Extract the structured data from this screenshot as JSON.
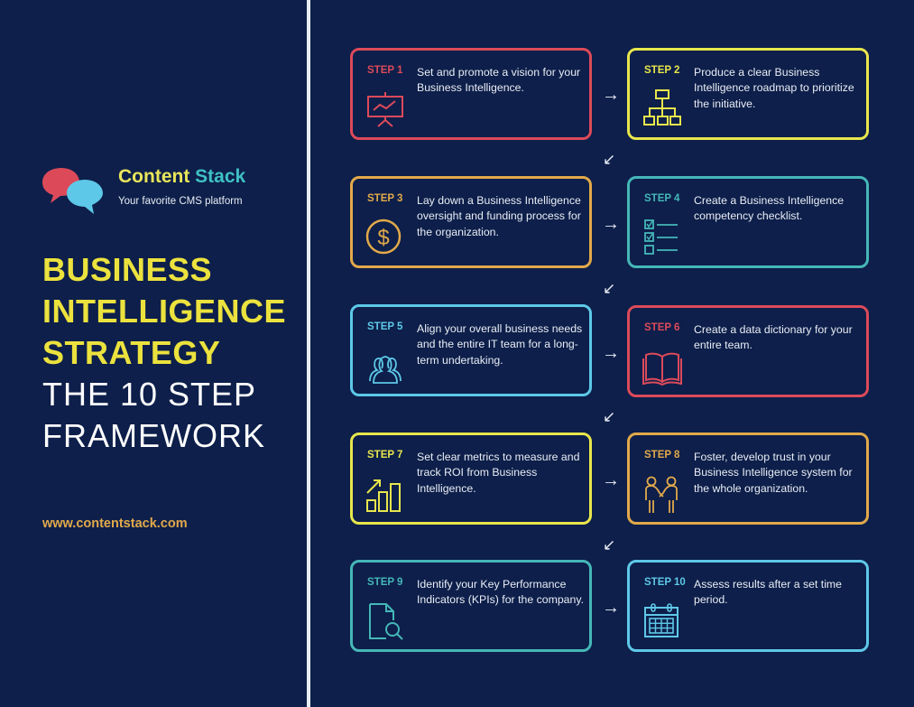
{
  "brand": {
    "name_part1": "Content",
    "name_part2": "Stack",
    "tagline": "Your favorite CMS platform",
    "url": "www.contentstack.com",
    "logo_icon": "chat-bubbles-icon"
  },
  "title": {
    "line1": "BUSINESS",
    "line2": "INTELLIGENCE",
    "line3": "STRATEGY",
    "line4": "THE 10 STEP",
    "line5": "FRAMEWORK"
  },
  "colors": {
    "background": "#0d1f4a",
    "red": "#dc4a5a",
    "yellow": "#e8e64c",
    "orange": "#e2a94a",
    "teal": "#45b7b8",
    "blue": "#5ec8e8",
    "title_yellow": "#ece23e"
  },
  "arrows": {
    "right": "→",
    "down_left": "↙"
  },
  "steps": [
    {
      "label": "STEP 1",
      "text": "Set and promote a vision for your Business Intelligence.",
      "icon": "presentation-chart-icon",
      "color": "#dc4a5a"
    },
    {
      "label": "STEP 2",
      "text": "Produce a clear Business Intelligence roadmap to prioritize the initiative.",
      "icon": "org-chart-icon",
      "color": "#e8e64c"
    },
    {
      "label": "STEP 3",
      "text": "Lay down a Business Intelligence oversight and funding process for the organization.",
      "icon": "dollar-coin-icon",
      "color": "#e2a94a"
    },
    {
      "label": "STEP 4",
      "text": "Create a Business Intelligence competency checklist.",
      "icon": "checklist-icon",
      "color": "#45b7b8"
    },
    {
      "label": "STEP 5",
      "text": "Align your overall business needs and the entire IT team for a long-term undertaking.",
      "icon": "team-icon",
      "color": "#5ec8e8"
    },
    {
      "label": "STEP 6",
      "text": "Create a data dictionary for your entire team.",
      "icon": "open-book-icon",
      "color": "#dc4a5a"
    },
    {
      "label": "STEP 7",
      "text": "Set clear metrics to measure and track ROI from Business Intelligence.",
      "icon": "growth-bars-icon",
      "color": "#e8e64c"
    },
    {
      "label": "STEP 8",
      "text": "Foster, develop trust in your Business Intelligence system for the whole organization.",
      "icon": "handshake-people-icon",
      "color": "#e2a94a"
    },
    {
      "label": "STEP 9",
      "text": "Identify your Key Performance Indicators (KPIs) for the company.",
      "icon": "document-search-icon",
      "color": "#45b7b8"
    },
    {
      "label": "STEP 10",
      "text": "Assess results after a set time period.",
      "icon": "calendar-icon",
      "color": "#5ec8e8"
    }
  ]
}
